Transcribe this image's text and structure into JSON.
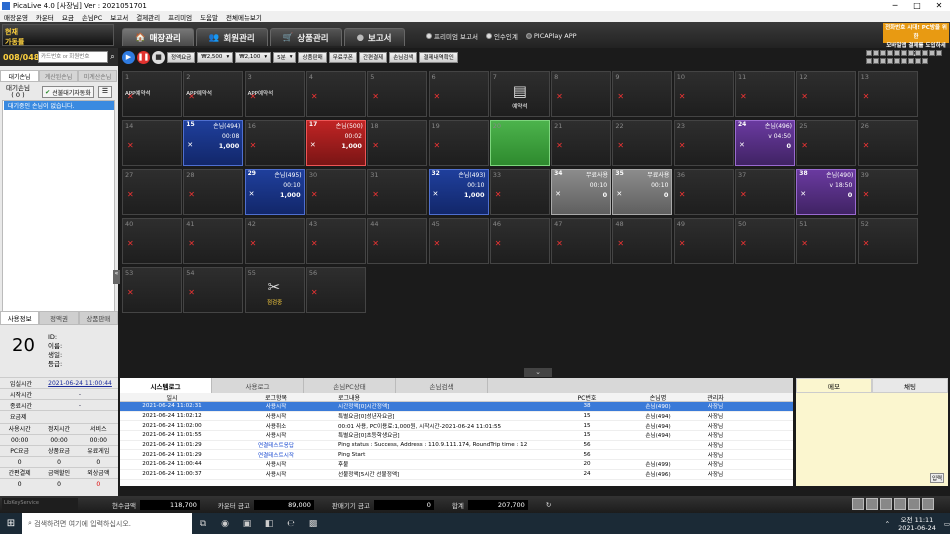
{
  "window": {
    "title": "PicaLive 4.0 [사장님] Ver : 2021051701"
  },
  "menu": [
    "매장운영",
    "카운터",
    "요금",
    "손님PC",
    "보고서",
    "결제관리",
    "프리미엄",
    "도움말",
    "전체메뉴보기"
  ],
  "logo": {
    "line1": "현재",
    "line2": "가동률"
  },
  "tabs": [
    {
      "label": "매장관리",
      "icon": "🏠"
    },
    {
      "label": "회원관리",
      "icon": "👥"
    },
    {
      "label": "상품관리",
      "icon": "🛒"
    },
    {
      "label": "보고서",
      "icon": "●"
    }
  ],
  "radios": [
    {
      "label": "프리미엄 보고서",
      "on": false
    },
    {
      "label": "인수인계",
      "on": false
    },
    {
      "label": "PICAPlay APP",
      "on": true
    }
  ],
  "promo": {
    "line1": "전화번호 시대! PC방을 위한",
    "line2": "모바일앱 결제를 도입하세요!"
  },
  "counter": {
    "value": "008/048",
    "search_placeholder": "카드번호 or 회원번호"
  },
  "left_tabs": [
    "대기손님",
    "계산된손님",
    "미계산손님"
  ],
  "waiting": {
    "label_line1": "대기손님",
    "label_line2": "( 0 )",
    "auto_btn": "선불대기자동화",
    "empty_msg": "대기중인 손님이 없습니다."
  },
  "info": {
    "tabs": [
      "사용정보",
      "정액권",
      "상품판매"
    ],
    "seat_number": "20",
    "labels": [
      "ID:",
      "이름:",
      "생일:",
      "등급:"
    ],
    "rows": [
      {
        "k": "입실시간",
        "v": "2021-06-24 11:00:44"
      },
      {
        "k": "시작시간",
        "v": "-"
      },
      {
        "k": "종료시간",
        "v": "-"
      },
      {
        "k": "요금제",
        "v": ""
      }
    ],
    "grid_headers1": [
      "사용시간",
      "정지시간",
      "서비스"
    ],
    "grid_values1": [
      "00:00",
      "00:00",
      "00:00"
    ],
    "grid_headers2": [
      "PC요금",
      "상품요금",
      "유료게임"
    ],
    "grid_values2": [
      "0",
      "0",
      "0"
    ],
    "grid_headers3": [
      "간편결제",
      "금액할인",
      "외상금액"
    ],
    "grid_values3": [
      "0",
      "0",
      "0"
    ]
  },
  "toolbar": {
    "buttons": [
      {
        "label": "정액요금",
        "dd": false
      },
      {
        "label": "₩2,500",
        "dd": true
      },
      {
        "label": "₩2,100",
        "dd": true
      },
      {
        "label": "5분",
        "dd": true
      },
      {
        "label": "상품판매",
        "dd": false
      },
      {
        "label": "무료쿠폰",
        "dd": false
      },
      {
        "label": "간편결제",
        "dd": false
      },
      {
        "label": "손님검색",
        "dd": false
      },
      {
        "label": "결제내역확인",
        "dd": false
      }
    ]
  },
  "seats": [
    {
      "no": "1",
      "state": "empty",
      "note": "APP예약석"
    },
    {
      "no": "2",
      "state": "empty",
      "note": "APP예약석"
    },
    {
      "no": "3",
      "state": "empty",
      "note": "APP예약석"
    },
    {
      "no": "4",
      "state": "empty"
    },
    {
      "no": "5",
      "state": "empty"
    },
    {
      "no": "6",
      "state": "empty"
    },
    {
      "no": "7",
      "state": "reserve",
      "center": "예약석"
    },
    {
      "no": "8",
      "state": "empty"
    },
    {
      "no": "9",
      "state": "empty"
    },
    {
      "no": "10",
      "state": "empty"
    },
    {
      "no": "11",
      "state": "empty"
    },
    {
      "no": "12",
      "state": "empty"
    },
    {
      "no": "13",
      "state": "empty"
    },
    {
      "no": "14",
      "state": "empty"
    },
    {
      "no": "15",
      "state": "blue",
      "name": "손님(494)",
      "l1": "00:08",
      "l2": "1,000"
    },
    {
      "no": "16",
      "state": "empty"
    },
    {
      "no": "17",
      "state": "red",
      "name": "손님(500)",
      "l1": "00:02",
      "l2": "1,000"
    },
    {
      "no": "18",
      "state": "empty"
    },
    {
      "no": "19",
      "state": "empty"
    },
    {
      "no": "20",
      "state": "green"
    },
    {
      "no": "21",
      "state": "empty"
    },
    {
      "no": "22",
      "state": "empty"
    },
    {
      "no": "23",
      "state": "empty"
    },
    {
      "no": "24",
      "state": "purple",
      "name": "손님(496)",
      "l1": "v 04:50",
      "l2": "0"
    },
    {
      "no": "25",
      "state": "empty"
    },
    {
      "no": "26",
      "state": "empty"
    },
    {
      "no": "27",
      "state": "empty"
    },
    {
      "no": "28",
      "state": "empty"
    },
    {
      "no": "29",
      "state": "blue",
      "name": "손님(495)",
      "l1": "00:10",
      "l2": "1,000"
    },
    {
      "no": "30",
      "state": "empty"
    },
    {
      "no": "31",
      "state": "empty"
    },
    {
      "no": "32",
      "state": "blue",
      "name": "손님(493)",
      "l1": "00:10",
      "l2": "1,000"
    },
    {
      "no": "33",
      "state": "empty"
    },
    {
      "no": "34",
      "state": "gray",
      "name": "무료사용",
      "l1": "00:10",
      "l2": "0"
    },
    {
      "no": "35",
      "state": "gray",
      "name": "무료사용",
      "l1": "00:10",
      "l2": "0"
    },
    {
      "no": "36",
      "state": "empty"
    },
    {
      "no": "37",
      "state": "empty"
    },
    {
      "no": "38",
      "state": "purple",
      "name": "손님(490)",
      "l1": "v 18:50",
      "l2": "0"
    },
    {
      "no": "39",
      "state": "empty"
    },
    {
      "no": "40",
      "state": "empty"
    },
    {
      "no": "41",
      "state": "empty"
    },
    {
      "no": "42",
      "state": "empty"
    },
    {
      "no": "43",
      "state": "empty"
    },
    {
      "no": "44",
      "state": "empty"
    },
    {
      "no": "45",
      "state": "empty"
    },
    {
      "no": "46",
      "state": "empty"
    },
    {
      "no": "47",
      "state": "empty"
    },
    {
      "no": "48",
      "state": "empty"
    },
    {
      "no": "49",
      "state": "empty"
    },
    {
      "no": "50",
      "state": "empty"
    },
    {
      "no": "51",
      "state": "empty"
    },
    {
      "no": "52",
      "state": "empty"
    },
    {
      "no": "53",
      "state": "empty"
    },
    {
      "no": "54",
      "state": "empty"
    },
    {
      "no": "55",
      "state": "maint",
      "center": "점검중"
    },
    {
      "no": "56",
      "state": "empty"
    }
  ],
  "log": {
    "tabs": [
      "시스템로그",
      "사용로그",
      "손님PC상태",
      "손님검색"
    ],
    "headers": [
      "일시",
      "로그항목",
      "로그내용",
      "PC번호",
      "손님명",
      "관리자"
    ],
    "rows": [
      {
        "t": "2021-06-24 11:02:31",
        "k": "사용시작",
        "m": "시간정액[0]시간정액]",
        "pc": "38",
        "u": "손님(490)",
        "a": "사장님",
        "sel": true
      },
      {
        "t": "2021-06-24 11:02:12",
        "k": "사용시작",
        "m": "특별요금[0]성년자요금]",
        "pc": "15",
        "u": "손님(494)",
        "a": "사장님"
      },
      {
        "t": "2021-06-24 11:02:00",
        "k": "사용취소",
        "m": "00:01 사용, PC이용료:1,000원, 시작시간-2021-06-24 11:01:55",
        "pc": "15",
        "u": "손님(494)",
        "a": "사장님"
      },
      {
        "t": "2021-06-24 11:01:55",
        "k": "사용시작",
        "m": "특별요금[0]초등학생요금]",
        "pc": "15",
        "u": "손님(494)",
        "a": "사장님"
      },
      {
        "t": "2021-06-24 11:01:29",
        "k": "연결테스트응답",
        "m": "Ping status : Success, Address : 110.9.111.174, RoundTrip time : 12",
        "pc": "56",
        "u": "",
        "a": "사장님",
        "blue": true
      },
      {
        "t": "2021-06-24 11:01:29",
        "k": "연결테스트시작",
        "m": "Ping Start",
        "pc": "56",
        "u": "",
        "a": "사장님",
        "blue": true
      },
      {
        "t": "2021-06-24 11:00:44",
        "k": "사용시작",
        "m": "후불",
        "pc": "20",
        "u": "손님(499)",
        "a": "사장님"
      },
      {
        "t": "2021-06-24 11:00:37",
        "k": "사용시작",
        "m": "선불정액[5시간 선불정액]",
        "pc": "24",
        "u": "손님(496)",
        "a": "사장님"
      }
    ]
  },
  "memo": {
    "tabs": [
      "메모",
      "채팅"
    ],
    "enter": "입력"
  },
  "bottom": {
    "stats": [
      {
        "label": "현수금액",
        "value": "118,700"
      },
      {
        "label": "카운터 금고",
        "value": "89,000"
      },
      {
        "label": "판매기기 금고",
        "value": "0"
      },
      {
        "label": "합계",
        "value": "207,700"
      }
    ],
    "side": "LibKeyService"
  },
  "taskbar": {
    "search": "검색하려면 여기에 입력하십시오.",
    "time": "오전 11:11",
    "date": "2021-06-24"
  }
}
